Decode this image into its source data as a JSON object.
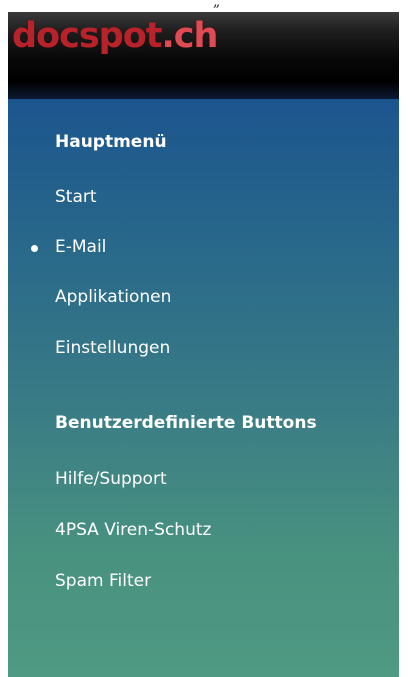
{
  "top_mark": "„",
  "header": {
    "logo_main": "docspot",
    "logo_tld": ".ch"
  },
  "main_menu": {
    "title": "Hauptmenü",
    "items": [
      {
        "label": "Start",
        "active": false
      },
      {
        "label": "E-Mail",
        "active": true
      },
      {
        "label": "Applikationen",
        "active": false
      },
      {
        "label": "Einstellungen",
        "active": false
      }
    ]
  },
  "custom_buttons": {
    "title": "Benutzerdefinierte Buttons",
    "items": [
      {
        "label": "Hilfe/Support"
      },
      {
        "label": "4PSA Viren-Schutz"
      },
      {
        "label": "Spam Filter"
      }
    ]
  },
  "colors": {
    "logo_red": "#b8232b",
    "nav_top": "#1c558e",
    "nav_bottom": "#4f9a82",
    "text": "#ffffff"
  }
}
